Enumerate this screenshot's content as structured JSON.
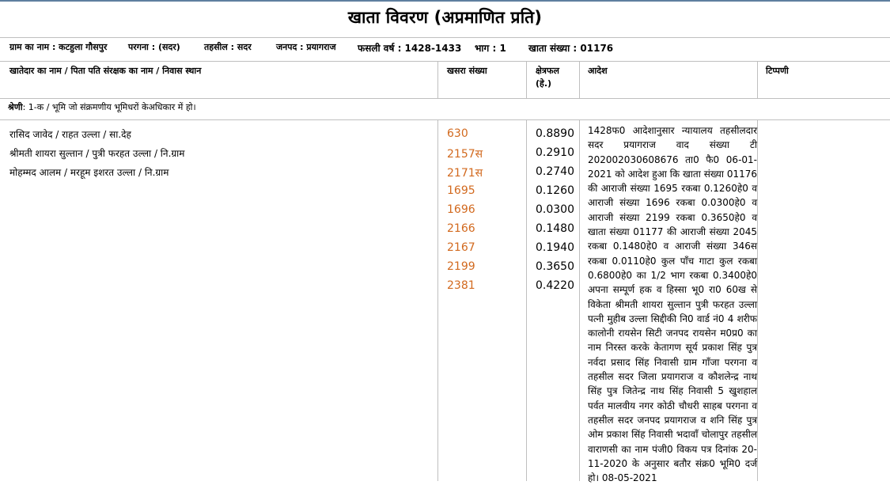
{
  "title": "खाता विवरण (अप्रमाणित प्रति)",
  "meta": {
    "village": "ग्राम का नाम : कटहुला गौसपुर",
    "pargana": "परगना : (सदर)",
    "tehsil": "तहसील : सदर",
    "district": "जनपद : प्रयागराज",
    "fasli": "फसली वर्ष : 1428-1433",
    "bhag": "भाग : 1",
    "khata": "खाता संख्या : 01176"
  },
  "headers": {
    "owner": "खातेदार का नाम / पिता पति संरक्षक का नाम / निवास स्थान",
    "khasra": "खसरा संख्या",
    "area_line1": "क्षेत्रफल",
    "area_line2": "(हे.)",
    "order": "आदेश",
    "remark": "टिप्पणी"
  },
  "category": {
    "label": "श्रेणी",
    "text": ": 1-क / भूमि जो संक्रमणीय भूमिधरों केअधिकार में हो।"
  },
  "owners": [
    "रासिद जावेद / राहत उल्ला / सा.देह",
    "श्रीमती शायरा सुल्तान / पुत्री फरहत उल्ला / नि.ग्राम",
    "मोहम्मद आलम / मरहूम इशरत उल्ला / नि.ग्राम"
  ],
  "plots": [
    {
      "khasra": "630",
      "area": "0.8890"
    },
    {
      "khasra": "2157स",
      "area": "0.2910"
    },
    {
      "khasra": "2171स",
      "area": "0.2740"
    },
    {
      "khasra": "1695",
      "area": "0.1260"
    },
    {
      "khasra": "1696",
      "area": "0.0300"
    },
    {
      "khasra": "2166",
      "area": "0.1480"
    },
    {
      "khasra": "2167",
      "area": "0.1940"
    },
    {
      "khasra": "2199",
      "area": "0.3650"
    },
    {
      "khasra": "2381",
      "area": "0.4220"
    }
  ],
  "order_text": "1428फ0 आदेशानुसार न्यायालय तहसीलदार सदर प्रयागराज वाद संख्या टी 202002030608676 ता0 फै0 06-01-2021 को आदेश हुआ कि खाता संख्या 01176 की आराजी संख्या 1695 रकबा 0.1260हे0 व आराजी संख्या 1696 रकबा 0.0300हे0 व आराजी संख्या 2199 रकबा 0.3650हे0 व खाता संख्या 01177 की आराजी संख्या 2045 रकबा 0.1480हे0 व आराजी संख्या 346स रकबा 0.0110हे0 कुल पाँच गाटा कुल रकबा 0.6800हे0 का 1/2 भाग रकबा 0.3400हे0 अपना सम्पूर्ण हक व हिस्सा भू0 रा0 60ख से विकेता श्रीमती शायरा सुल्तान पुत्री फरहत उल्ला पत्नी मुहीब उल्ला सिद्दीकी नि0 वार्ड नं0 4 शरीफ कालोनी रायसेन सिटी जनपद रायसेन म0प्र0 का नाम निरस्त करके केतागण सूर्य प्रकाश सिंह पुत्र नर्वदा प्रसाद सिंह निवासी ग्राम गाँजा परगना व तहसील सदर जिला प्रयागराज व कौशलेन्द्र नाथ सिंह पुत्र जितेन्द्र नाथ सिंह निवासी 5 खुशहाल पर्वत मालवीय नगर कोठी चौधरी साहब परगना व तहसील सदर जनपद प्रयागराज व शनि सिंह पुत्र ओम प्रकाश सिंह निवासी भदावाँ चोलापुर तहसील वाराणसी का नाम पंजी0 विकय पत्र दिनांक 20-11-2020 के अनुसार बतौर संक्र0 भूमि0 दर्ज हो। 08-05-2021"
}
